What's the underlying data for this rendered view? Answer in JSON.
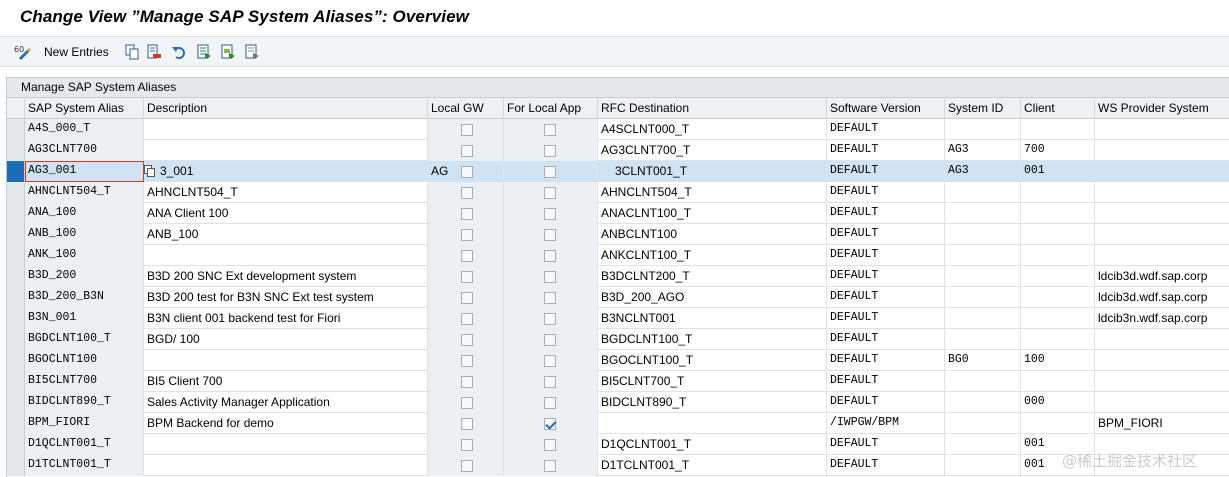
{
  "title": "Change View ”Manage SAP System Aliases”: Overview",
  "toolbar": {
    "new_entries_label": "New Entries",
    "icons": [
      "display-change-icon",
      "copy-icon",
      "delete-icon",
      "undo-icon",
      "select-all-icon",
      "select-block-icon",
      "deselect-all-icon"
    ]
  },
  "grid": {
    "caption": "Manage SAP System Aliases",
    "columns": [
      "SAP System Alias",
      "Description",
      "Local GW",
      "For Local App",
      "RFC Destination",
      "Software Version",
      "System ID",
      "Client",
      "WS Provider System"
    ],
    "rows": [
      {
        "alias": "A4S_000_T",
        "desc": "",
        "local_gw": "",
        "local_app": false,
        "rfc": "A4SCLNT000_T",
        "sw": "DEFAULT",
        "sysid": "",
        "client": "",
        "ws": ""
      },
      {
        "alias": "AG3CLNT700",
        "desc": "",
        "local_gw": "",
        "local_app": false,
        "rfc": "AG3CLNT700_T",
        "sw": "DEFAULT",
        "sysid": "AG3",
        "client": "700",
        "ws": ""
      },
      {
        "alias": "AG3_001",
        "desc": "3_001",
        "local_gw": "AG",
        "local_app": false,
        "rfc": "3CLNT001_T",
        "sw": "DEFAULT",
        "sysid": "AG3",
        "client": "001",
        "ws": "",
        "selected": true
      },
      {
        "alias": "AHNCLNT504_T",
        "desc": "AHNCLNT504_T",
        "local_gw": "",
        "local_app": false,
        "rfc": "AHNCLNT504_T",
        "sw": "DEFAULT",
        "sysid": "",
        "client": "",
        "ws": ""
      },
      {
        "alias": "ANA_100",
        "desc": "ANA Client 100",
        "local_gw": "",
        "local_app": false,
        "rfc": "ANACLNT100_T",
        "sw": "DEFAULT",
        "sysid": "",
        "client": "",
        "ws": ""
      },
      {
        "alias": "ANB_100",
        "desc": "ANB_100",
        "local_gw": "",
        "local_app": false,
        "rfc": "ANBCLNT100",
        "sw": "DEFAULT",
        "sysid": "",
        "client": "",
        "ws": ""
      },
      {
        "alias": "ANK_100",
        "desc": "",
        "local_gw": "",
        "local_app": false,
        "rfc": "ANKCLNT100_T",
        "sw": "DEFAULT",
        "sysid": "",
        "client": "",
        "ws": ""
      },
      {
        "alias": "B3D_200",
        "desc": "B3D 200 SNC Ext development system",
        "local_gw": "",
        "local_app": false,
        "rfc": "B3DCLNT200_T",
        "sw": "DEFAULT",
        "sysid": "",
        "client": "",
        "ws": "ldcib3d.wdf.sap.corp"
      },
      {
        "alias": "B3D_200_B3N",
        "desc": "B3D 200 test for B3N SNC Ext test system",
        "local_gw": "",
        "local_app": false,
        "rfc": "B3D_200_AGO",
        "sw": "DEFAULT",
        "sysid": "",
        "client": "",
        "ws": "ldcib3d.wdf.sap.corp"
      },
      {
        "alias": "B3N_001",
        "desc": "B3N client 001 backend test for Fiori",
        "local_gw": "",
        "local_app": false,
        "rfc": "B3NCLNT001",
        "sw": "DEFAULT",
        "sysid": "",
        "client": "",
        "ws": "ldcib3n.wdf.sap.corp"
      },
      {
        "alias": "BGDCLNT100_T",
        "desc": "BGD/ 100",
        "local_gw": "",
        "local_app": false,
        "rfc": "BGDCLNT100_T",
        "sw": "DEFAULT",
        "sysid": "",
        "client": "",
        "ws": ""
      },
      {
        "alias": "BGOCLNT100",
        "desc": "",
        "local_gw": "",
        "local_app": false,
        "rfc": "BGOCLNT100_T",
        "sw": "DEFAULT",
        "sysid": "BG0",
        "client": "100",
        "ws": ""
      },
      {
        "alias": "BI5CLNT700",
        "desc": "BI5 Client 700",
        "local_gw": "",
        "local_app": false,
        "rfc": "BI5CLNT700_T",
        "sw": "DEFAULT",
        "sysid": "",
        "client": "",
        "ws": ""
      },
      {
        "alias": "BIDCLNT890_T",
        "desc": "Sales Activity Manager Application",
        "local_gw": "",
        "local_app": false,
        "rfc": "BIDCLNT890_T",
        "sw": "DEFAULT",
        "sysid": "",
        "client": "000",
        "ws": ""
      },
      {
        "alias": "BPM_FIORI",
        "desc": "BPM Backend for demo",
        "local_gw": "",
        "local_app": true,
        "rfc": "",
        "sw": "/IWPGW/BPM",
        "sysid": "",
        "client": "",
        "ws": "BPM_FIORI"
      },
      {
        "alias": "D1QCLNT001_T",
        "desc": "",
        "local_gw": "",
        "local_app": false,
        "rfc": "D1QCLNT001_T",
        "sw": "DEFAULT",
        "sysid": "",
        "client": "001",
        "ws": ""
      },
      {
        "alias": "D1TCLNT001_T",
        "desc": "",
        "local_gw": "",
        "local_app": false,
        "rfc": "D1TCLNT001_T",
        "sw": "DEFAULT",
        "sysid": "",
        "client": "001",
        "ws": ""
      }
    ]
  },
  "watermark": "@稀土掘金技术社区",
  "colors": {
    "selected_row": "#cfe3f2",
    "row_marker": "#1b6eb5",
    "check": "#1d6fb8",
    "edit_border": "#d03a2a"
  }
}
